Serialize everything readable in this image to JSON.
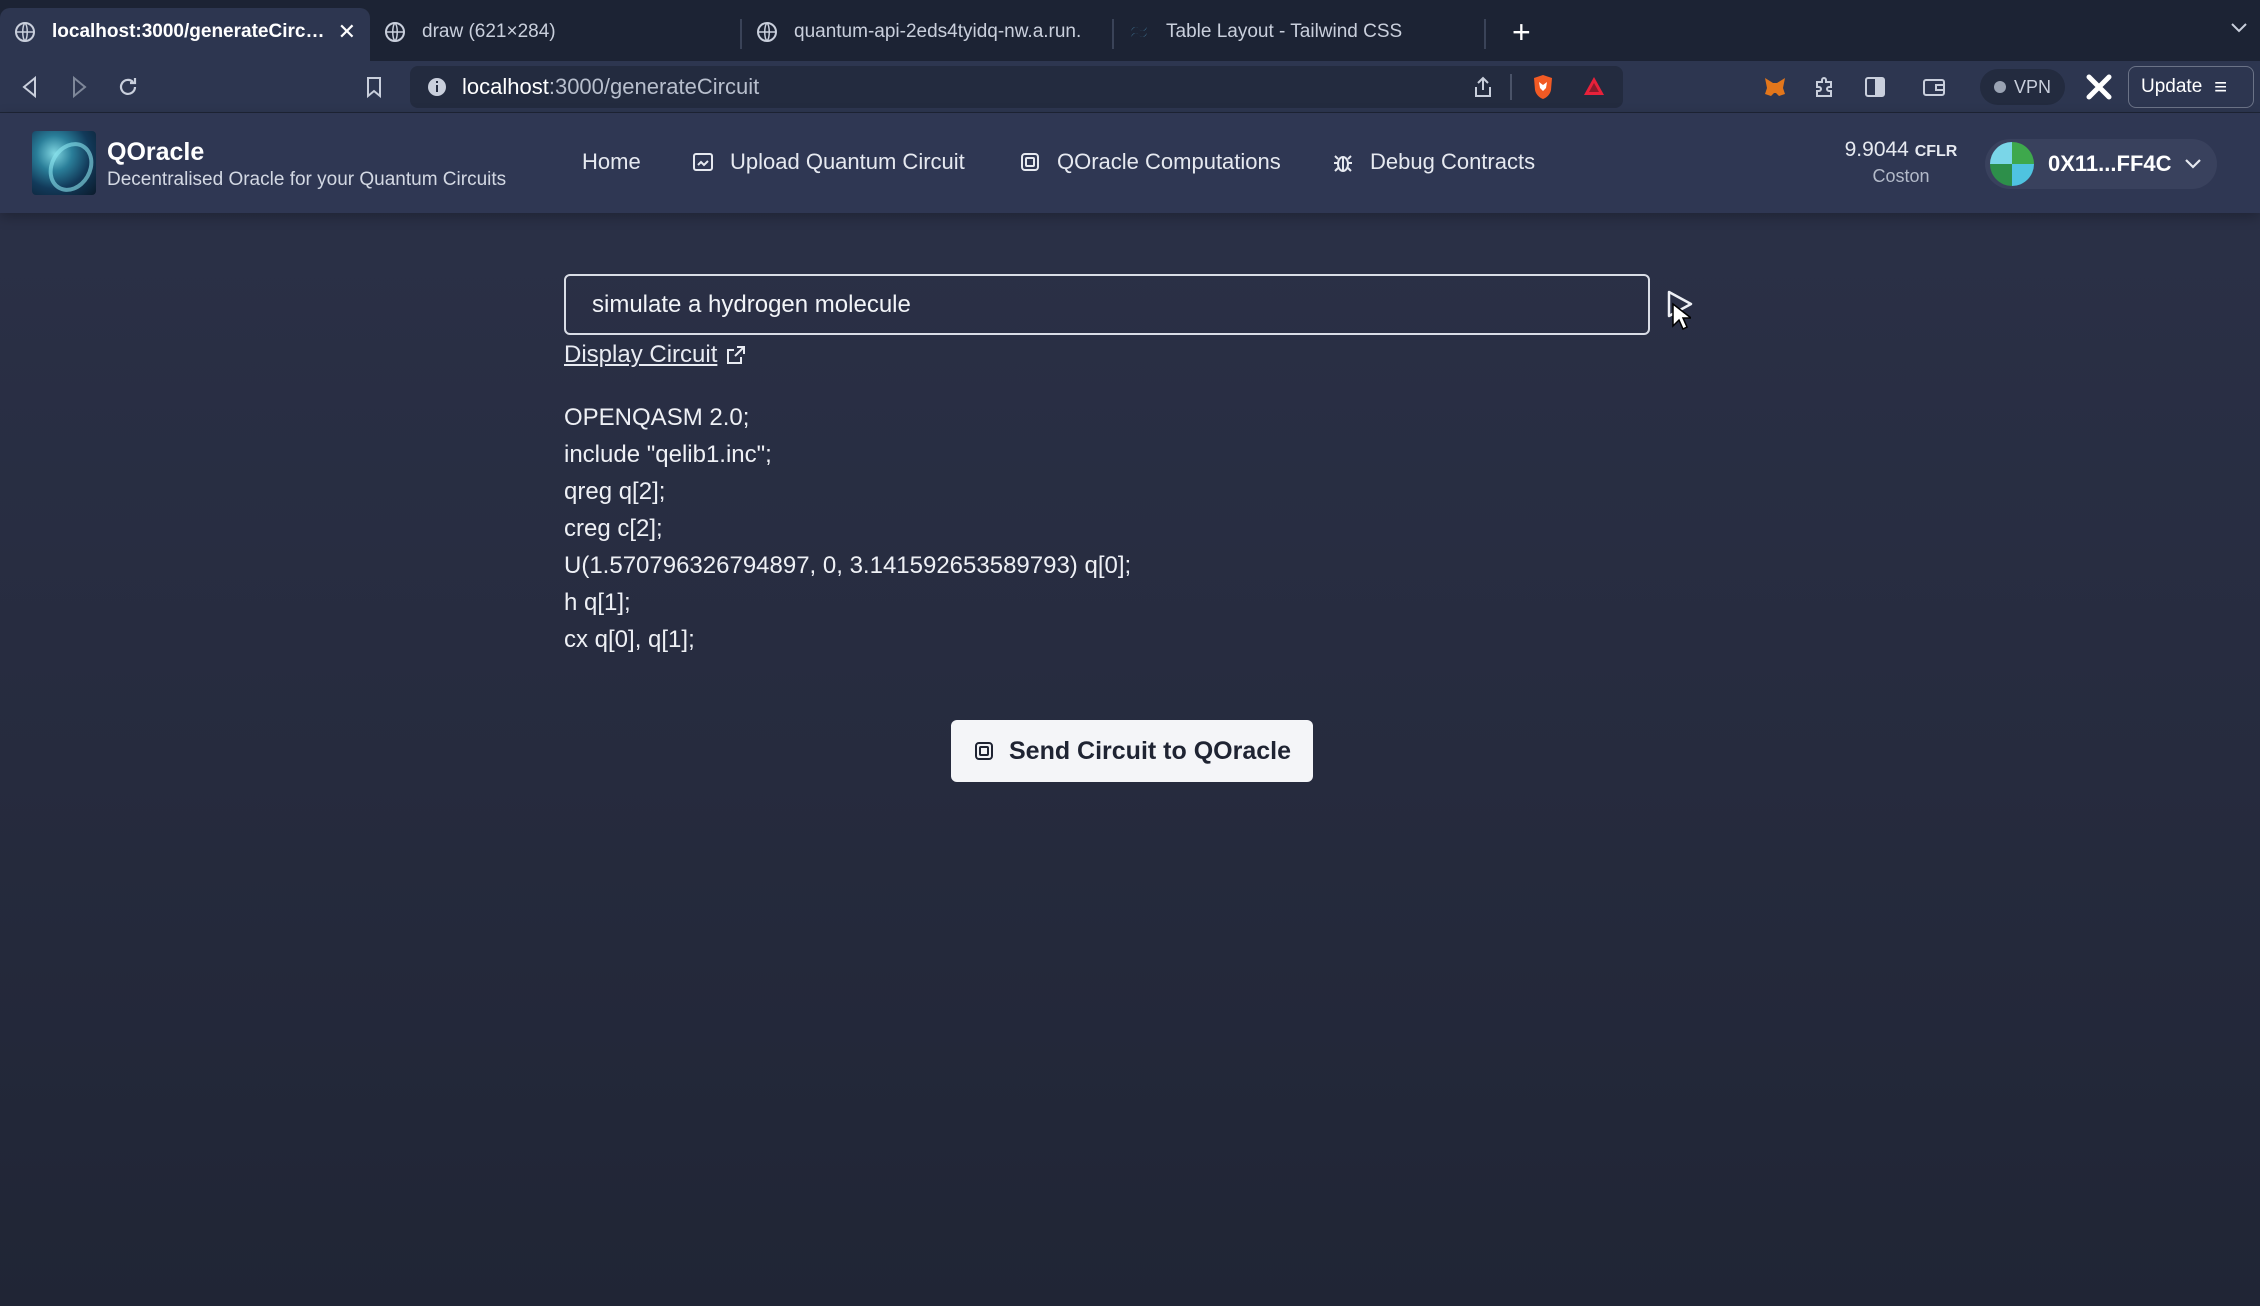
{
  "browser": {
    "tabs": [
      {
        "title": "localhost:3000/generateCircuit",
        "active": true,
        "close": "✕"
      },
      {
        "title": "draw (621×284)",
        "active": false
      },
      {
        "title": "quantum-api-2eds4tyidq-nw.a.run.",
        "active": false
      },
      {
        "title": "Table Layout - Tailwind CSS",
        "active": false
      }
    ],
    "new_tab": "+",
    "url": {
      "host": "localhost",
      "path": ":3000/generateCircuit"
    },
    "vpn_label": "VPN",
    "update_label": "Update"
  },
  "app": {
    "brand": {
      "title": "QOracle",
      "subtitle": "Decentralised Oracle for your Quantum Circuits"
    },
    "nav": [
      {
        "label": "Home",
        "icon": "none"
      },
      {
        "label": "Upload Quantum Circuit",
        "icon": "upload-icon"
      },
      {
        "label": "QOracle Computations",
        "icon": "cpu-icon"
      },
      {
        "label": "Debug Contracts",
        "icon": "bug-icon"
      }
    ],
    "balance": {
      "amount": "9.9044",
      "unit": "CFLR",
      "network": "Coston"
    },
    "account": {
      "address": "0X11...FF4C"
    },
    "prompt": {
      "value": "simulate a hydrogen molecule"
    },
    "display_circuit_label": "Display Circuit",
    "code_lines": [
      "OPENQASM 2.0;",
      "include \"qelib1.inc\";",
      "qreg q[2];",
      "creg c[2];",
      "U(1.570796326794897, 0, 3.141592653589793) q[0];",
      "h q[1];",
      "cx q[0], q[1];"
    ],
    "send_button_label": "Send Circuit to QOracle"
  },
  "colors": {
    "background": "#2a3044",
    "navbar": "#2f3753",
    "button": "#f4f5f8"
  }
}
